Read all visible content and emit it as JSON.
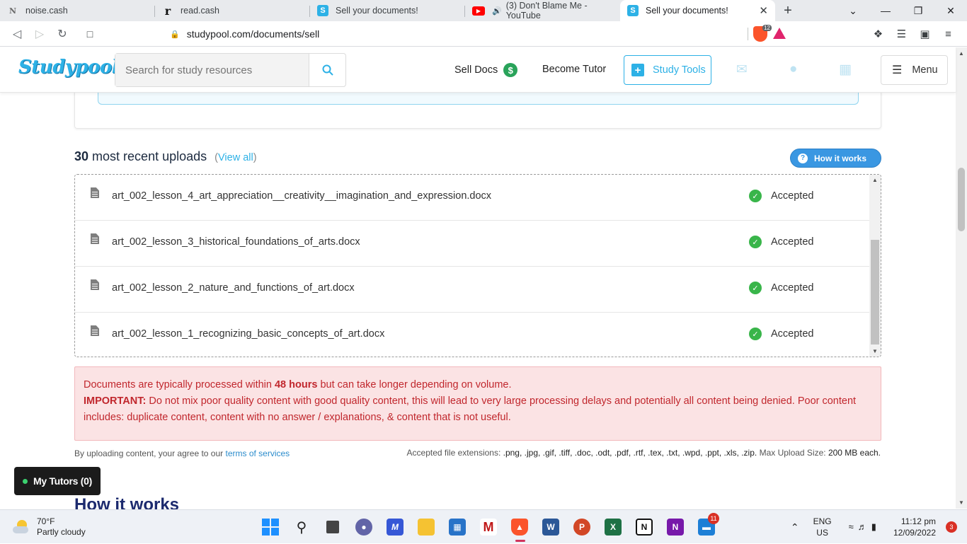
{
  "browser": {
    "tabs": [
      {
        "title": "noise.cash",
        "favicon": "N",
        "active": false
      },
      {
        "title": "read.cash",
        "favicon": "r",
        "active": false
      },
      {
        "title": "Sell your documents!",
        "favicon": "S",
        "active": false
      },
      {
        "title": "(3) Don't Blame Me - YouTube",
        "favicon": "yt",
        "active": false
      },
      {
        "title": "Sell your documents!",
        "favicon": "S",
        "active": true
      }
    ],
    "url": "studypool.com/documents/sell",
    "brave_shield_count": "12"
  },
  "header": {
    "logo": "Studypool",
    "search_placeholder": "Search for study resources",
    "sell_docs": "Sell Docs",
    "become_tutor": "Become Tutor",
    "study_tools": "Study Tools",
    "menu": "Menu"
  },
  "uploads": {
    "count": "30",
    "title_rest": "most recent uploads",
    "view_all_open": "(",
    "view_all": "View all",
    "view_all_close": ")",
    "how_it_works_button": "How it works",
    "items": [
      {
        "filename": "art_002_lesson_4_art_appreciation__creativity__imagination_and_expression.docx",
        "status": "Accepted"
      },
      {
        "filename": "art_002_lesson_3_historical_foundations_of_arts.docx",
        "status": "Accepted"
      },
      {
        "filename": "art_002_lesson_2_nature_and_functions_of_art.docx",
        "status": "Accepted"
      },
      {
        "filename": "art_002_lesson_1_recognizing_basic_concepts_of_art.docx",
        "status": "Accepted"
      }
    ]
  },
  "notice": {
    "line1_pre": "Documents are typically processed within ",
    "line1_bold": "48 hours",
    "line1_post": " but can take longer depending on volume.",
    "important_label": "IMPORTANT:",
    "important_text": " Do not mix poor quality content with good quality content, this will lead to very large processing delays and potentially all content being denied. Poor content includes: duplicate content, content with no answer / explanations, & content that is not useful."
  },
  "footer": {
    "terms_pre": "By uploading content, your agree to our ",
    "terms_link": "terms of services",
    "ext_label": "Accepted file extensions: ",
    "ext_list": ".png, .jpg, .gif, .tiff, .doc, .odt, .pdf, .rtf, .tex, .txt, .wpd, .ppt, .xls, .zip.",
    "max_label": " Max Upload Size: ",
    "max_value": "200 MB each."
  },
  "my_tutors": "My Tutors (0)",
  "section_heading": "How it works",
  "taskbar": {
    "temperature": "70°F",
    "weather": "Partly cloudy",
    "lang1": "ENG",
    "lang2": "US",
    "time": "11:12 pm",
    "date": "12/09/2022",
    "notifications": "3",
    "app_badge": "11"
  },
  "colors": {
    "brand": "#2db1e6",
    "accepted": "#39b54a",
    "notice_bg": "#fbe3e4",
    "notice_text": "#c1272d"
  }
}
